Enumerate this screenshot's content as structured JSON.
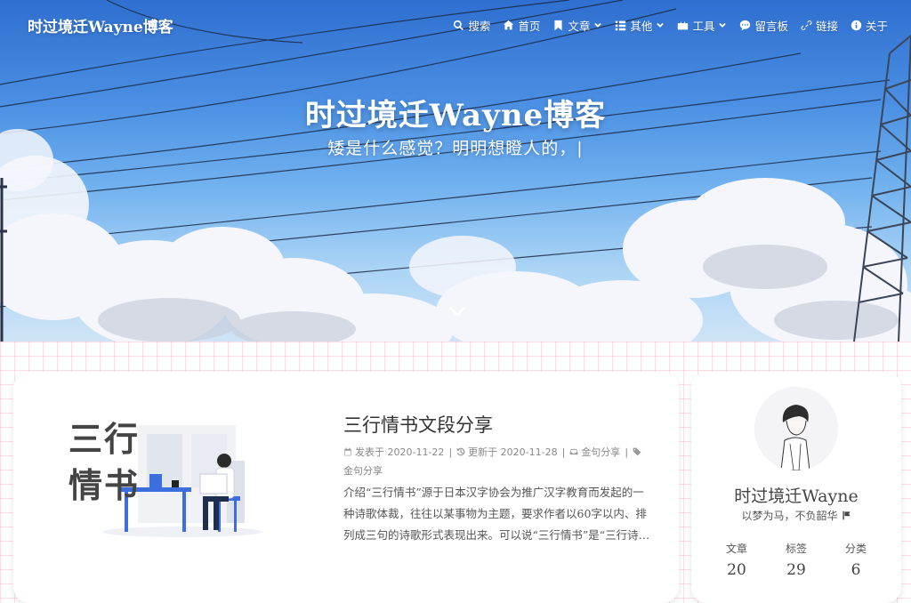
{
  "site": {
    "name": "时过境迁Wayne博客"
  },
  "nav": {
    "items": [
      {
        "label": "搜索",
        "icon": "search-icon"
      },
      {
        "label": "首页",
        "icon": "home-icon"
      },
      {
        "label": "文章",
        "icon": "bookmark-icon",
        "dropdown": true
      },
      {
        "label": "其他",
        "icon": "list-icon",
        "dropdown": true
      },
      {
        "label": "工具",
        "icon": "toolbox-icon",
        "dropdown": true
      },
      {
        "label": "留言板",
        "icon": "comment-icon"
      },
      {
        "label": "链接",
        "icon": "link-icon"
      },
      {
        "label": "关于",
        "icon": "info-icon"
      }
    ]
  },
  "hero": {
    "title": "时过境迁Wayne博客",
    "subtitle": "矮是什么感觉？明明想瞪人的，|"
  },
  "post": {
    "cover_text_line1": "三行",
    "cover_text_line2": "情书",
    "title": "三行情书文段分享",
    "published_label": "发表于",
    "published_date": "2020-11-22",
    "updated_label": "更新于",
    "updated_date": "2020-11-28",
    "category": "金句分享",
    "tag": "金句分享",
    "excerpt": "介绍“三行情书”源于日本汉字协会为推广汉字教育而发起的一种诗歌体裁，往往以某事物为主题，要求作者以60字以内、排列成三句的诗歌形式表现出来。可以说“三行情书”是“三行诗…"
  },
  "author": {
    "name": "时过境迁Wayne",
    "description": "以梦为马，不负韶华",
    "stats": [
      {
        "label": "文章",
        "value": "20"
      },
      {
        "label": "标签",
        "value": "29"
      },
      {
        "label": "分类",
        "value": "6"
      }
    ]
  },
  "colors": {
    "sky": "#4a8fe3",
    "grid_line": "#ffa0af",
    "text": "#333333"
  }
}
